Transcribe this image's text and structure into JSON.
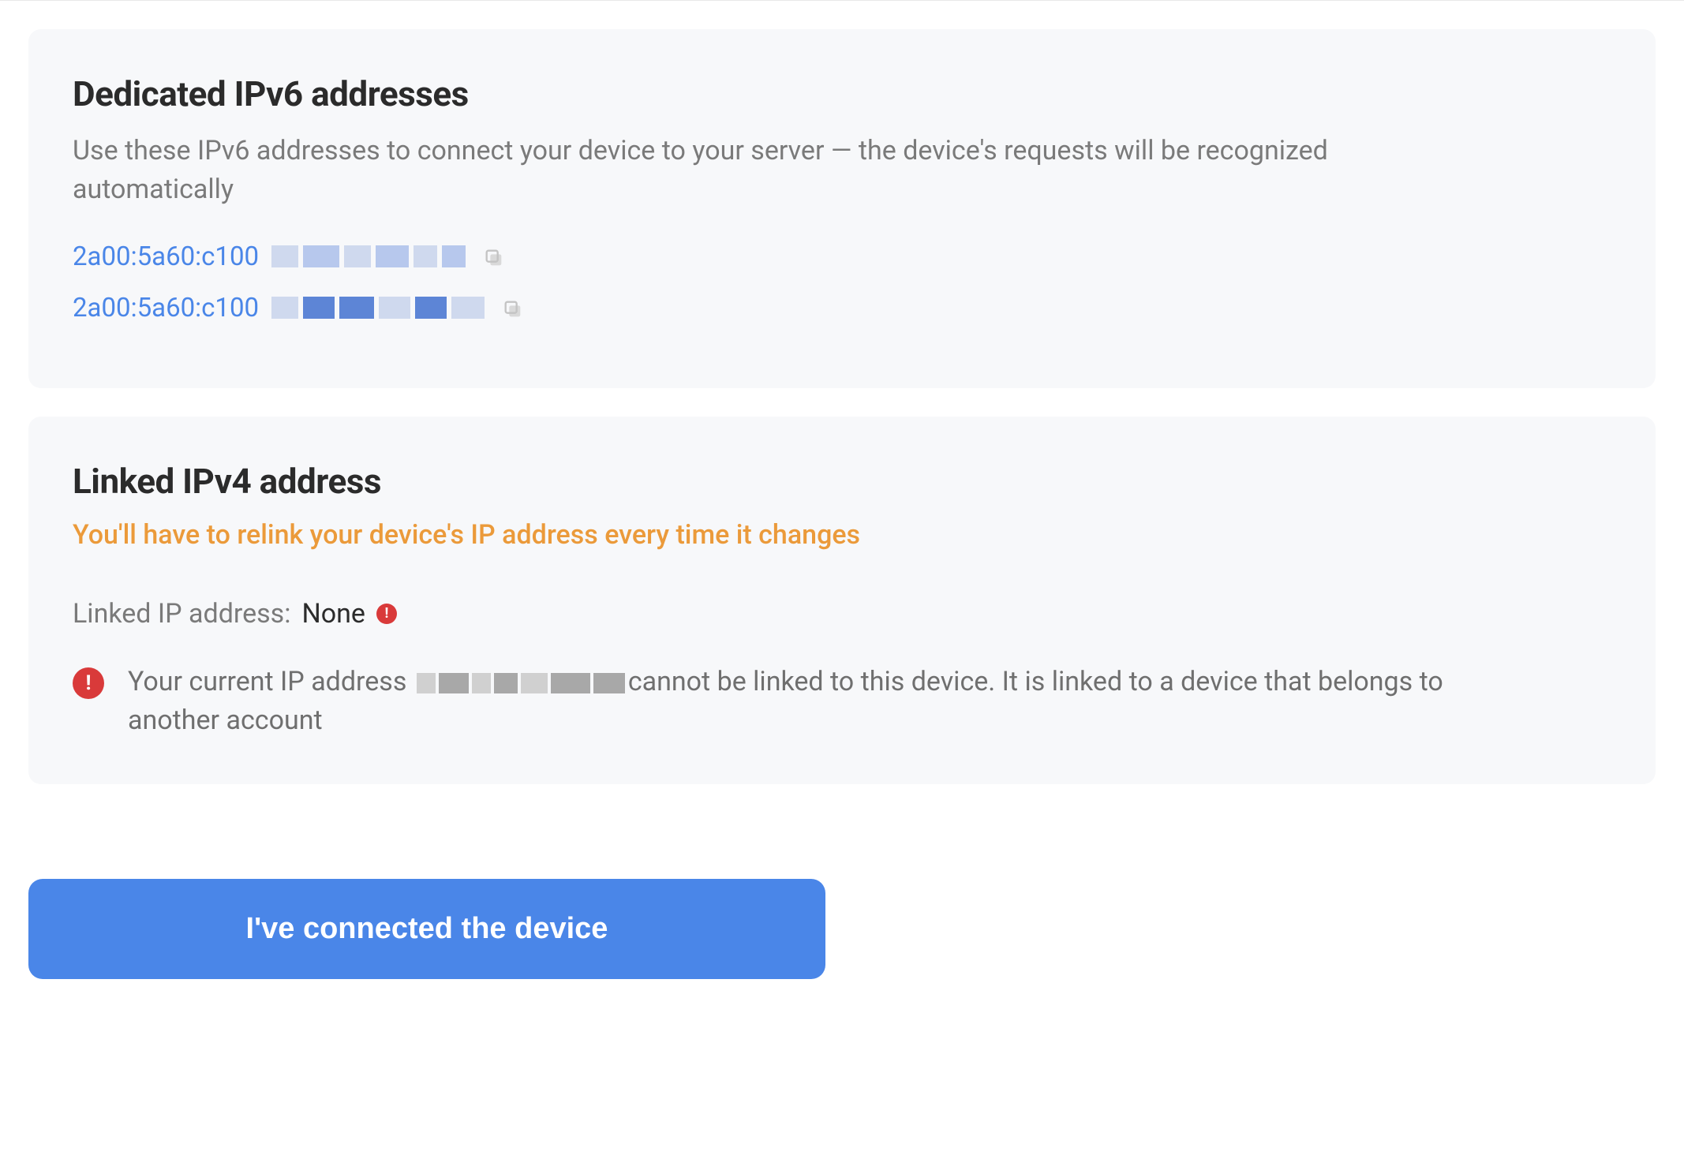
{
  "ipv6": {
    "title": "Dedicated IPv6 addresses",
    "description": "Use these IPv6 addresses to connect your device to your server — the device's requests will be recognized automatically",
    "addresses": [
      {
        "visible_prefix": "2a00:5a60:c100",
        "redacted": true
      },
      {
        "visible_prefix": "2a00:5a60:c100",
        "redacted": true
      }
    ]
  },
  "ipv4": {
    "title": "Linked IPv4 address",
    "warning": "You'll have to relink your device's IP address every time it changes",
    "linked_label": "Linked IP address:",
    "linked_value": "None",
    "alert": {
      "prefix": "Your current IP address ",
      "suffix": "cannot be linked to this device. It is linked to a device that belongs to another account",
      "current_ip_redacted": true
    }
  },
  "cta": {
    "label": "I've connected the device"
  },
  "icons": {
    "copy": "copy-icon",
    "alert": "alert-icon"
  },
  "colors": {
    "card_bg": "#f7f8fa",
    "link_blue": "#4a86e8",
    "warn_orange": "#eb9a3a",
    "error_red": "#d93a3a",
    "text_muted": "#7a7a7a",
    "text_body": "#2b2b2b"
  }
}
